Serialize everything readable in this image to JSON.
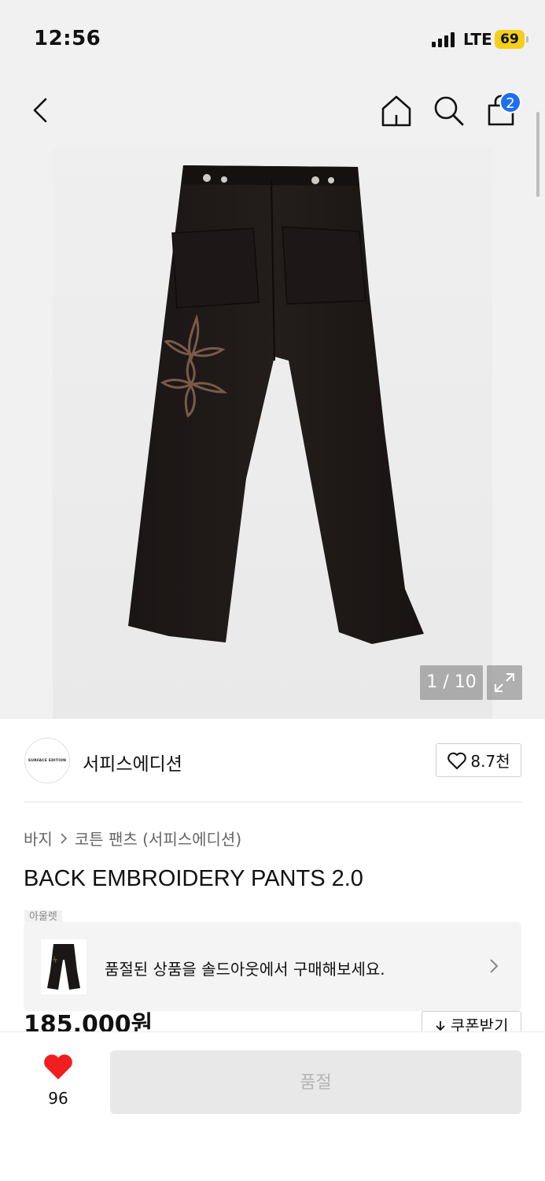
{
  "status_bar": {
    "time": "12:56",
    "network": "LTE",
    "battery": "69",
    "battery_color": "#f3cf1b"
  },
  "nav": {
    "back_icon": "chevron-left-icon",
    "home_icon": "home-icon",
    "search_icon": "search-icon",
    "cart_icon": "shopping-bag-icon",
    "cart_badge": "2",
    "badge_color": "#1e6ff1"
  },
  "gallery": {
    "counter": "1 / 10",
    "expand_icon": "expand-icon"
  },
  "brand": {
    "logo_text": "SURFACE EDITION",
    "name": "서피스에디션",
    "like_count": "8.7천"
  },
  "breadcrumb": {
    "category": "바지",
    "subcategory": "코튼 팬츠 (서피스에디션)"
  },
  "product": {
    "title": "BACK EMBROIDERY PANTS 2.0",
    "outlet_tag": "아울렛",
    "price": "185,000원",
    "coupon_label": "쿠폰받기"
  },
  "soldout_banner": {
    "text": "품절된 상품을 솔드아웃에서 구매해보세요."
  },
  "bottom_bar": {
    "wish_count": "96",
    "wish_color": "#f01e1e",
    "action_label": "품절"
  }
}
